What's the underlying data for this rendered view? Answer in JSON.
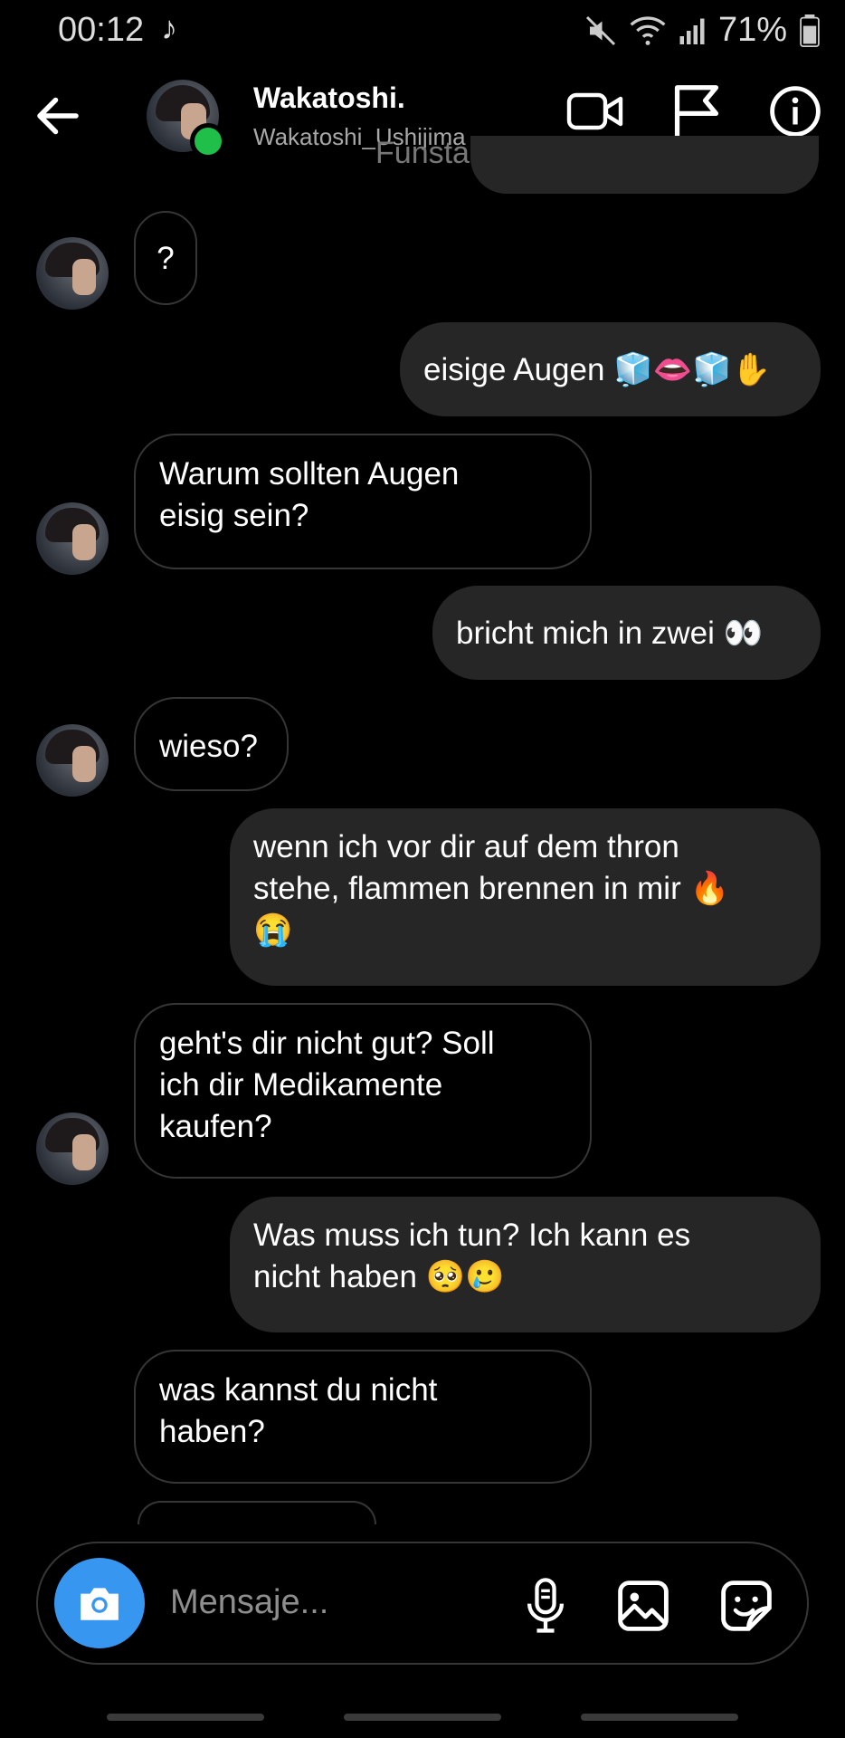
{
  "status": {
    "time": "00:12",
    "battery": "71%"
  },
  "header": {
    "name": "Wakatoshi.",
    "username": "Wakatoshi_Ushijima",
    "overlay": "Funsta"
  },
  "messages": [
    {
      "dir": "in",
      "text": "?"
    },
    {
      "dir": "out",
      "text": "eisige Augen 🧊👄🧊✋"
    },
    {
      "dir": "in",
      "line1": "Warum sollten Augen",
      "line2": "eisig sein?"
    },
    {
      "dir": "out",
      "text": "bricht mich in zwei 👀"
    },
    {
      "dir": "in",
      "text": "wieso?"
    },
    {
      "dir": "out",
      "line1": "wenn ich vor dir auf dem thron",
      "line2": "stehe, flammen brennen in mir 🔥",
      "line3": "😭"
    },
    {
      "dir": "in",
      "line1": "geht's dir nicht gut? Soll",
      "line2": "ich dir Medikamente",
      "line3": "kaufen?"
    },
    {
      "dir": "out",
      "line1": "Was muss ich tun? Ich kann es",
      "line2": "nicht haben 🥺🥲"
    },
    {
      "dir": "in",
      "line1": "was kannst du nicht",
      "line2": "haben?"
    }
  ],
  "composer": {
    "placeholder": "Mensaje..."
  }
}
